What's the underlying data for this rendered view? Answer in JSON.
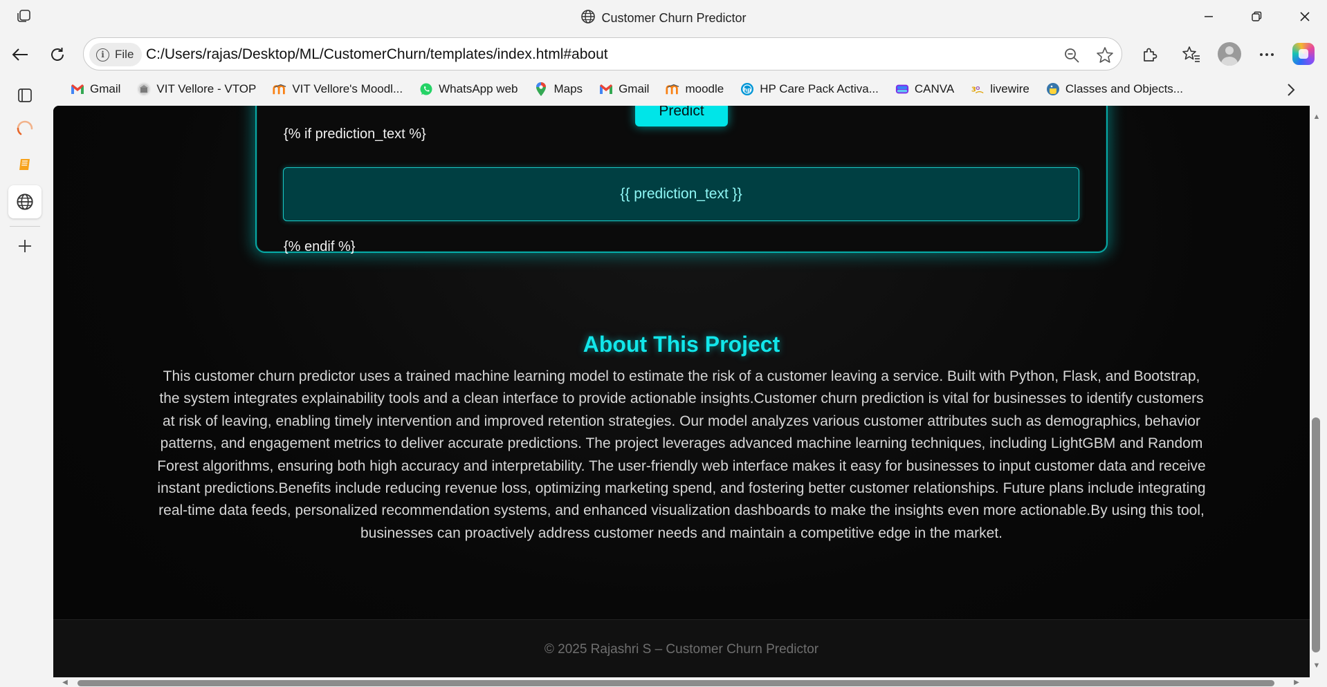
{
  "window": {
    "title": "Customer Churn Predictor"
  },
  "address_bar": {
    "scheme_label": "File",
    "url": "C:/Users/rajas/Desktop/ML/CustomerChurn/templates/index.html#about"
  },
  "bookmarks": [
    {
      "label": "Gmail",
      "icon": "gmail-icon",
      "color": "#ea4335"
    },
    {
      "label": "VIT Vellore - VTOP",
      "icon": "vtop-icon",
      "color": "#6b6b6b"
    },
    {
      "label": "VIT Vellore's Moodl...",
      "icon": "moodle-icon",
      "color": "#f98012"
    },
    {
      "label": "WhatsApp web",
      "icon": "whatsapp-icon",
      "color": "#25d366"
    },
    {
      "label": "Maps",
      "icon": "maps-icon",
      "color": "#34a853"
    },
    {
      "label": "Gmail",
      "icon": "gmail-icon",
      "color": "#ea4335"
    },
    {
      "label": "moodle",
      "icon": "moodle-icon",
      "color": "#f98012"
    },
    {
      "label": "HP Care Pack Activa...",
      "icon": "hp-icon",
      "color": "#0096d6"
    },
    {
      "label": "CANVA",
      "icon": "canva-icon",
      "color": "#7d2ae8"
    },
    {
      "label": "livewire",
      "icon": "livewire-icon",
      "color": "#e0a100"
    },
    {
      "label": "Classes and Objects...",
      "icon": "python-icon",
      "color": "#3776ab"
    }
  ],
  "page": {
    "predict_button": "Predict",
    "jinja_if": "{% if prediction_text %}",
    "prediction_placeholder": "{{ prediction_text }}",
    "jinja_endif": "{% endif %}",
    "about_title": "About This Project",
    "about_text": "This customer churn predictor uses a trained machine learning model to estimate the risk of a customer leaving a service. Built with Python, Flask, and Bootstrap, the system integrates explainability tools and a clean interface to provide actionable insights.Customer churn prediction is vital for businesses to identify customers at risk of leaving, enabling timely intervention and improved retention strategies. Our model analyzes various customer attributes such as demographics, behavior patterns, and engagement metrics to deliver accurate predictions. The project leverages advanced machine learning techniques, including LightGBM and Random Forest algorithms, ensuring both high accuracy and interpretability. The user-friendly web interface makes it easy for businesses to input customer data and receive instant predictions.Benefits include reducing revenue loss, optimizing marketing spend, and fostering better customer relationships. Future plans include integrating real-time data feeds, personalized recommendation systems, and enhanced visualization dashboards to make the insights even more actionable.By using this tool, businesses can proactively address customer needs and maintain a competitive edge in the market.",
    "footer": "© 2025 Rajashri S – Customer Churn Predictor"
  },
  "colors": {
    "accent": "#00e5e8",
    "page_background": "#050505",
    "browser_chrome": "#f3f3f3"
  }
}
